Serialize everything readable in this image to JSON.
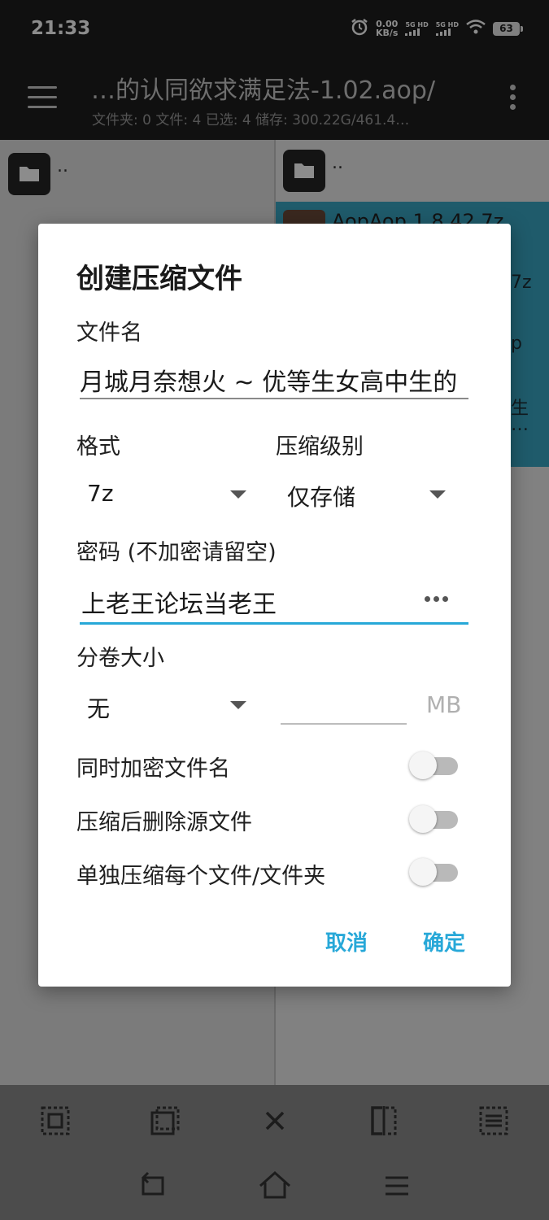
{
  "status_bar": {
    "time": "21:33",
    "net_speed_value": "0.00",
    "net_speed_unit": "KB/s",
    "sim1_label": "5G HD",
    "sim2_label": "5G HD",
    "battery": "63"
  },
  "app_bar": {
    "title": "…的认同欲求满足法-1.02.aop/",
    "subtitle": "文件夹: 0  文件: 4  已选: 4  储存: 300.22G/461.4…"
  },
  "left_panel": {
    "parent_label": ".."
  },
  "right_panel": {
    "parent_label": "..",
    "selected_file_name": "AopAop 1.8.42.7z",
    "peek_texts": [
      "7z",
      "p",
      "生",
      "…"
    ]
  },
  "dialog": {
    "title": "创建压缩文件",
    "filename_label": "文件名",
    "filename_value": "月城月奈想火 ~ 优等生女高中生的",
    "format_label": "格式",
    "format_value": "7z",
    "level_label": "压缩级别",
    "level_value": "仅存储",
    "password_label": "密码 (不加密请留空)",
    "password_value": "上老王论坛当老王",
    "volume_label": "分卷大小",
    "volume_value": "无",
    "volume_unit": "MB",
    "toggles": [
      {
        "label": "同时加密文件名",
        "on": false
      },
      {
        "label": "压缩后删除源文件",
        "on": false
      },
      {
        "label": "单独压缩每个文件/文件夹",
        "on": false
      }
    ],
    "cancel_label": "取消",
    "ok_label": "确定"
  },
  "colors": {
    "accent": "#27a8d8",
    "selection": "#3aa7c4",
    "bar": "#1e1e1e"
  }
}
